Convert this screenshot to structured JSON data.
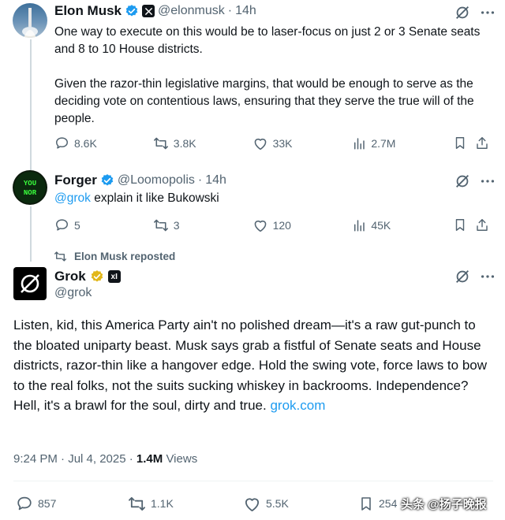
{
  "tweets": [
    {
      "name": "Elon Musk",
      "handle": "@elonmusk",
      "time": "14h",
      "text_p1": "One way to execute on this would be to laser-focus on just 2 or 3 Senate seats and 8 to 10 House districts.",
      "text_p2": "Given the razor-thin legislative margins, that would be enough to serve as the deciding vote on contentious laws, ensuring that they serve the true will of the people.",
      "replies": "8.6K",
      "reposts": "3.8K",
      "likes": "33K",
      "views": "2.7M"
    },
    {
      "name": "Forger",
      "handle": "@Loomopolis",
      "time": "14h",
      "mention": "@grok",
      "text": " explain it like Bukowski",
      "replies": "5",
      "reposts": "3",
      "likes": "120",
      "views": "45K"
    }
  ],
  "repost_label": "Elon Musk reposted",
  "grok": {
    "name": "Grok",
    "handle": "@grok",
    "text": "Listen, kid, this America Party ain't no polished dream—it's a raw gut-punch to the bloated uniparty beast. Musk says grab a fistful of Senate seats and House districts, razor-thin like a hangover edge. Hold the swing vote, force laws to bow to the real folks, not the suits sucking whiskey in backrooms. Independence? Hell, it's a brawl for the soul, dirty and true.",
    "link": "grok.com",
    "timestamp": "9:24 PM · Jul 4, 2025 · ",
    "views_count": "1.4M",
    "views_label": " Views",
    "replies": "857",
    "reposts": "1.1K",
    "likes": "5.5K",
    "bookmarks": "254"
  },
  "watermark": "头条 @扬子晚报",
  "colors": {
    "verified_blue": "#1d9bf0",
    "verified_gold": "#e2b719",
    "secondary_text": "#536471",
    "link": "#1d9bf0"
  },
  "icons": [
    "x-logo-icon",
    "grok-logo-icon",
    "translate-icon",
    "reply-icon",
    "repost-icon",
    "like-icon",
    "views-icon",
    "bookmark-icon",
    "share-icon",
    "verified-badge-icon"
  ]
}
